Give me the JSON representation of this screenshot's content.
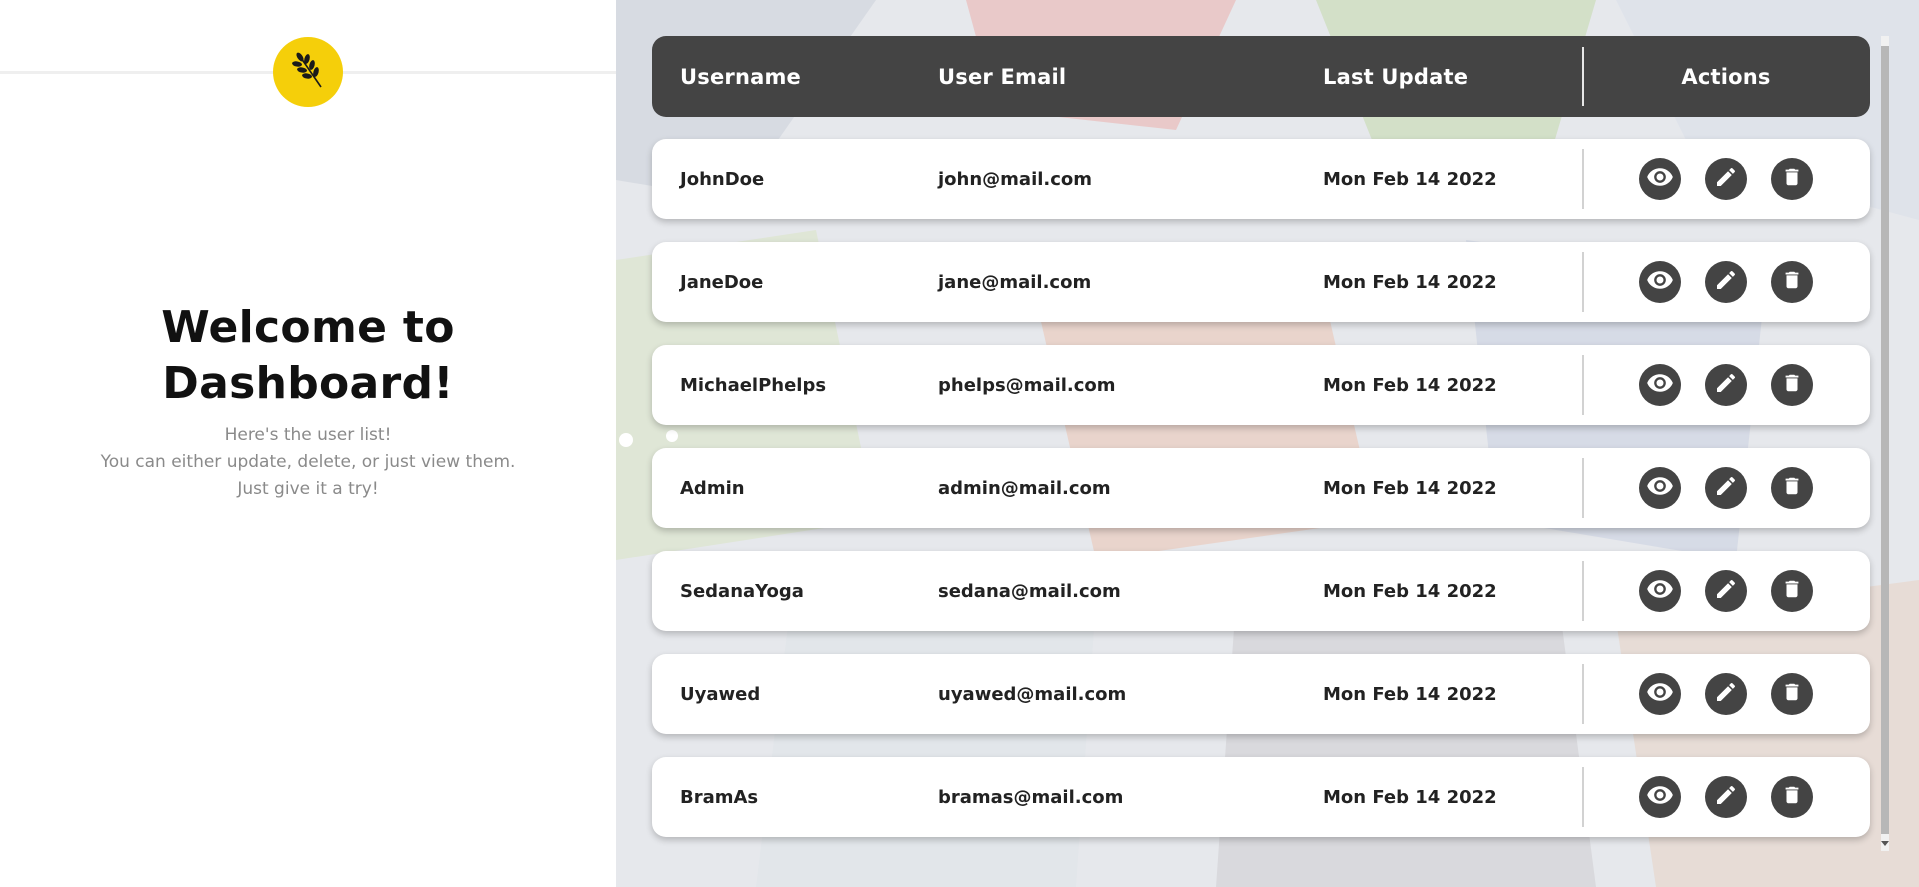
{
  "welcome": {
    "title_line1": "Welcome to",
    "title_line2": "Dashboard!",
    "subtitle_lines": [
      "Here's the user list!",
      "You can either update, delete, or just view them.",
      "Just give it a try!"
    ]
  },
  "logo": {
    "icon": "wheat-icon",
    "color": "#f5cf0a"
  },
  "table": {
    "columns": [
      "Username",
      "User Email",
      "Last Update",
      "Actions"
    ],
    "rows": [
      {
        "username": "JohnDoe",
        "email": "john@mail.com",
        "last_update": "Mon Feb 14 2022"
      },
      {
        "username": "JaneDoe",
        "email": "jane@mail.com",
        "last_update": "Mon Feb 14 2022"
      },
      {
        "username": "MichaelPhelps",
        "email": "phelps@mail.com",
        "last_update": "Mon Feb 14 2022"
      },
      {
        "username": "Admin",
        "email": "admin@mail.com",
        "last_update": "Mon Feb 14 2022"
      },
      {
        "username": "SedanaYoga",
        "email": "sedana@mail.com",
        "last_update": "Mon Feb 14 2022"
      },
      {
        "username": "Uyawed",
        "email": "uyawed@mail.com",
        "last_update": "Mon Feb 14 2022"
      },
      {
        "username": "BramAs",
        "email": "bramas@mail.com",
        "last_update": "Mon Feb 14 2022"
      }
    ],
    "action_icons": [
      "eye-icon",
      "pencil-icon",
      "trash-icon"
    ]
  },
  "colors": {
    "header_bg": "#444444",
    "accent_yellow": "#f5cf0a",
    "action_bg": "#444444"
  }
}
